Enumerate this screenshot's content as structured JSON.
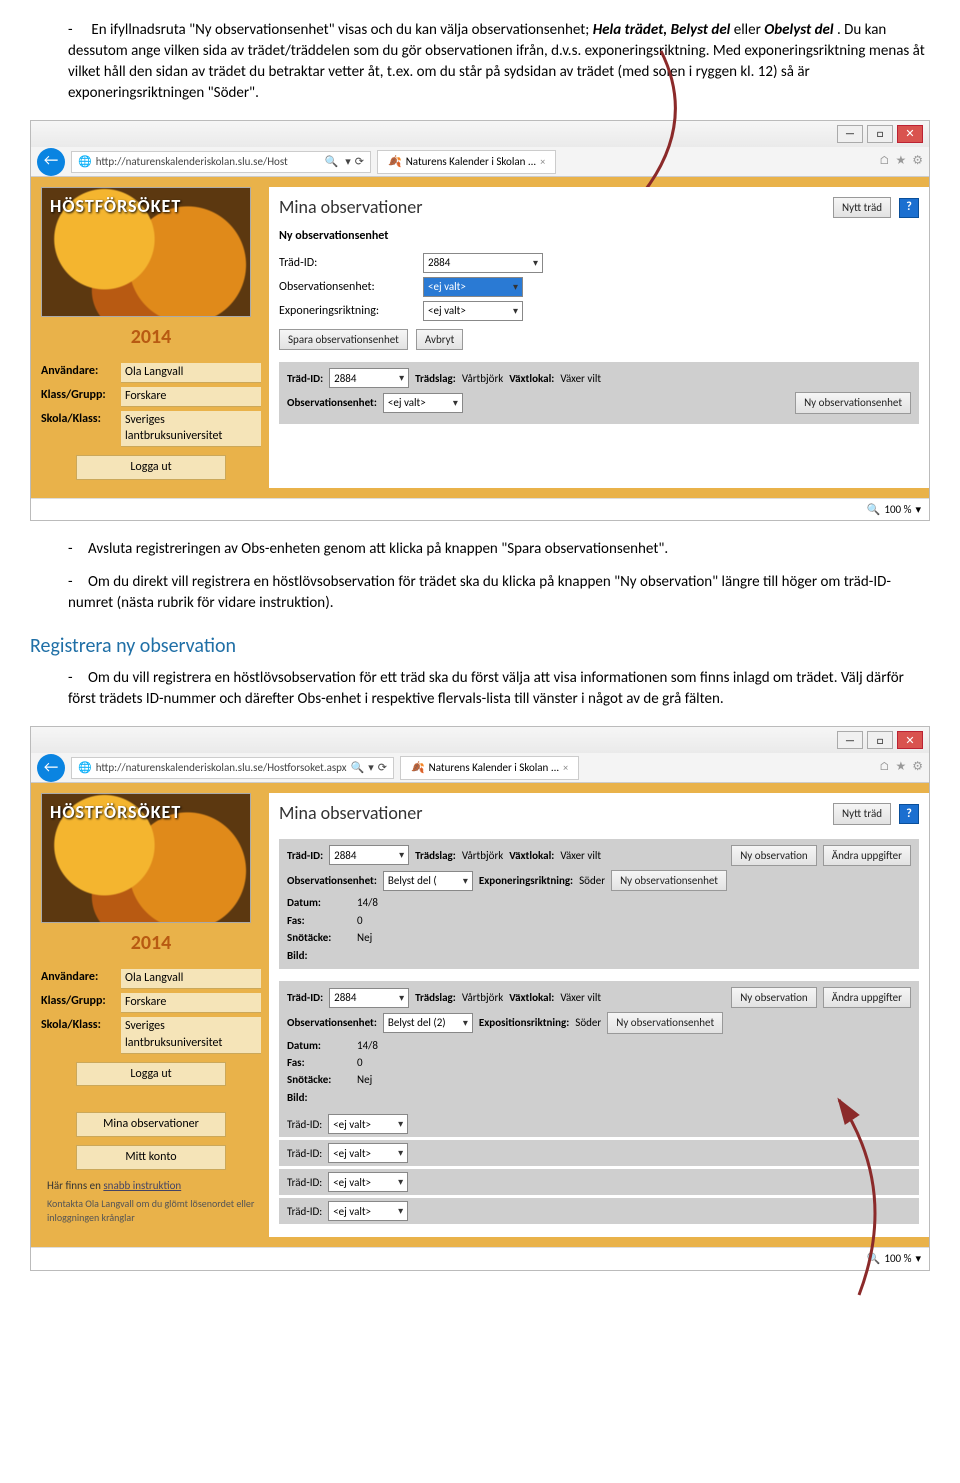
{
  "doc": {
    "para1": "En ifyllnadsruta \"Ny observationsenhet\" visas och du kan välja observationsenhet; ",
    "para1_italic": "Hela trädet, Belyst del ",
    "para1_b": "eller ",
    "para1_italic2": "Obelyst del",
    "para1_c": ". Du kan dessutom ange vilken sida av trädet/träddelen som du gör observationen ifrån, d.v.s. exponeringsriktning. Med exponeringsriktning menas åt vilket håll den sidan av trädet du betraktar vetter åt, t.ex. om du står på sydsidan av trädet (med solen i ryggen kl. 12) så är exponeringsriktningen \"Söder\".",
    "para2": "Avsluta registreringen av Obs-enheten genom att klicka på knappen \"Spara observationsenhet\".",
    "para3": "Om du direkt vill registrera en höstlövsobservation för trädet ska du klicka på knappen \"Ny observation\" längre till höger om träd-ID-numret (nästa rubrik för vidare instruktion).",
    "heading": "Registrera ny observation",
    "para4": "Om du vill registrera en höstlövsobservation för ett träd ska du först välja att visa informationen som finns inlagd om trädet. Välj därför först trädets ID-nummer och därefter Obs-enhet i respektive flervals-lista till vänster i något av de grå fälten."
  },
  "browser": {
    "url1": "http://naturenskalenderiskolan.slu.se/Host",
    "url2": "http://naturenskalenderiskolan.slu.se/Hostforsoket.aspx",
    "searchGlyph": "🔍",
    "refresh": "⟳",
    "tabTitle": "Naturens Kalender i Skolan ...",
    "zoom": "100 %"
  },
  "app": {
    "siteTitle": "HÖSTFÖRSÖKET",
    "year": "2014",
    "user_lbl": "Användare:",
    "user_val": "Ola Langvall",
    "group_lbl": "Klass/Grupp:",
    "group_val": "Forskare",
    "school_lbl": "Skola/Klass:",
    "school_val": "Sveriges lantbruksuniversitet",
    "logout": "Logga ut",
    "myobs_btn": "Mina observationer",
    "myacct_btn": "Mitt konto",
    "instr_txt": "Här finns en ",
    "instr_link": "snabb instruktion",
    "contact_txt": "Kontakta Ola Langvall om du glömt lösenordet eller inloggningen krånglar"
  },
  "main": {
    "title": "Mina observationer",
    "nytt_trad": "Nytt träd",
    "help": "?",
    "sub": "Ny observationsenhet",
    "tradid_lbl": "Träd-ID:",
    "tradid_val": "2884",
    "obs_lbl": "Observationsenhet:",
    "obs_val": "<ej valt>",
    "exp_lbl": "Exponeringsriktning:",
    "exp_val": "<ej valt>",
    "save": "Spara observationsenhet",
    "cancel": "Avbryt",
    "tradslag_lbl": "Trädslag:",
    "tradslag_val": "Vårtbjörk",
    "vaxtlokal_lbl": "Växtlokal:",
    "vaxtlokal_val": "Växer vilt",
    "nyobsenhet": "Ny observationsenhet",
    "nyobs": "Ny observation",
    "andra": "Ändra uppgifter"
  },
  "detail": {
    "obsenhet_val1": "Belyst del ( ",
    "obsenhet_val2": "Belyst del (2)",
    "exprikt_lbl": "Exponeringsriktning:",
    "exprikt_lbl2": "Expositionsriktning:",
    "exprikt_val": "Söder",
    "datum_lbl": "Datum:",
    "datum_val": "14/8",
    "fas_lbl": "Fas:",
    "fas_val": "0",
    "sno_lbl": "Snötäcke:",
    "sno_val": "Nej",
    "bild_lbl": "Bild:",
    "ejvalt": "<ej valt>"
  }
}
